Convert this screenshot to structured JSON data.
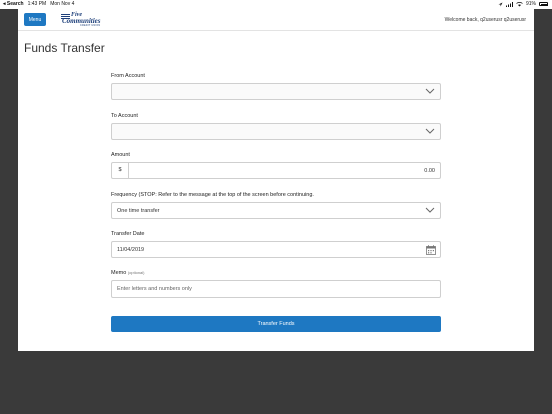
{
  "status_bar": {
    "back_label": "◂ Search",
    "time": "1:43 PM",
    "date": "Mon Nov 4",
    "battery": "91%"
  },
  "header": {
    "menu_label": "Menu",
    "logo_line1": "Five",
    "logo_line2": "Communities",
    "logo_line3": "CREDIT UNION",
    "welcome": "Welcome back, q2userusr q2userusr"
  },
  "form": {
    "title": "Funds Transfer",
    "from_account": {
      "label": "From Account",
      "value": ""
    },
    "to_account": {
      "label": "To Account",
      "value": ""
    },
    "amount": {
      "label": "Amount",
      "prefix": "$",
      "value": "0.00"
    },
    "frequency": {
      "label": "Frequency (STOP: Refer to the message at the top of the screen before continuing.",
      "value": "One time transfer"
    },
    "transfer_date": {
      "label": "Transfer Date",
      "value": "11/04/2019"
    },
    "memo": {
      "label": "Memo",
      "optional": "(optional)",
      "placeholder": "Enter letters and numbers only"
    },
    "submit_label": "Transfer Funds"
  },
  "colors": {
    "accent": "#1e78c2",
    "backdrop": "#3a3a3a"
  },
  "icons": {
    "dropdown": "chevron-down-icon",
    "date": "calendar-icon"
  }
}
